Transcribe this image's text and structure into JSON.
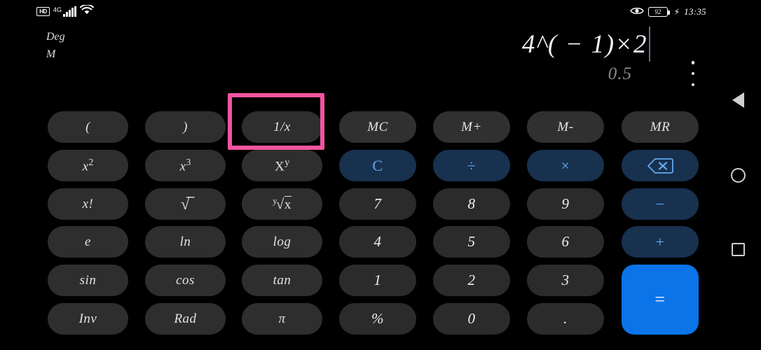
{
  "status_bar": {
    "hd_label": "HD",
    "network_label": "4G",
    "signal_icon": "signal-bars-icon",
    "wifi_icon": "wifi-icon",
    "eye_icon": "eye-icon",
    "battery_level": "92",
    "charging_icon": "charging-bolt-icon",
    "time": "13:35"
  },
  "display": {
    "angle_mode": "Deg",
    "memory_indicator": "M",
    "expression": "4^( − 1)×2",
    "result_preview": "0.5",
    "overflow_menu_icon": "overflow-menu-icon"
  },
  "annotation": {
    "highlight_color": "#f2559e",
    "highlighted_key": "1/x"
  },
  "keypad": {
    "keys": [
      {
        "id": "paren-open",
        "label": "(",
        "type": "fn",
        "col": 0,
        "row": 0
      },
      {
        "id": "paren-close",
        "label": ")",
        "type": "fn",
        "col": 1,
        "row": 0
      },
      {
        "id": "reciprocal",
        "label": "1/x",
        "type": "fn",
        "col": 2,
        "row": 0
      },
      {
        "id": "mem-clear",
        "label": "MC",
        "type": "mem",
        "col": 3,
        "row": 0
      },
      {
        "id": "mem-plus",
        "label": "M+",
        "type": "mem",
        "col": 4,
        "row": 0
      },
      {
        "id": "mem-minus",
        "label": "M-",
        "type": "mem",
        "col": 5,
        "row": 0
      },
      {
        "id": "mem-recall",
        "label": "MR",
        "type": "mem",
        "col": 6,
        "row": 0
      },
      {
        "id": "x-squared",
        "label": "x2",
        "type": "fn",
        "col": 0,
        "row": 1
      },
      {
        "id": "x-cubed",
        "label": "x3",
        "type": "fn",
        "col": 1,
        "row": 1
      },
      {
        "id": "x-pow-y",
        "label": "Xy",
        "type": "fn",
        "col": 2,
        "row": 1
      },
      {
        "id": "clear",
        "label": "C",
        "type": "op",
        "col": 3,
        "row": 1
      },
      {
        "id": "divide",
        "label": "÷",
        "type": "op",
        "col": 4,
        "row": 1
      },
      {
        "id": "multiply",
        "label": "×",
        "type": "op",
        "col": 5,
        "row": 1
      },
      {
        "id": "backspace",
        "label": "backspace-icon",
        "type": "op",
        "col": 6,
        "row": 1
      },
      {
        "id": "factorial",
        "label": "x!",
        "type": "fn",
        "col": 0,
        "row": 2
      },
      {
        "id": "sqrt",
        "label": "√",
        "type": "fn",
        "col": 1,
        "row": 2
      },
      {
        "id": "nth-root",
        "label": "y√x",
        "type": "fn",
        "col": 2,
        "row": 2
      },
      {
        "id": "digit-7",
        "label": "7",
        "type": "num",
        "col": 3,
        "row": 2
      },
      {
        "id": "digit-8",
        "label": "8",
        "type": "num",
        "col": 4,
        "row": 2
      },
      {
        "id": "digit-9",
        "label": "9",
        "type": "num",
        "col": 5,
        "row": 2
      },
      {
        "id": "subtract",
        "label": "−",
        "type": "op",
        "col": 6,
        "row": 2
      },
      {
        "id": "euler",
        "label": "e",
        "type": "fn",
        "col": 0,
        "row": 3
      },
      {
        "id": "natural-log",
        "label": "ln",
        "type": "fn",
        "col": 1,
        "row": 3
      },
      {
        "id": "log",
        "label": "log",
        "type": "fn",
        "col": 2,
        "row": 3
      },
      {
        "id": "digit-4",
        "label": "4",
        "type": "num",
        "col": 3,
        "row": 3
      },
      {
        "id": "digit-5",
        "label": "5",
        "type": "num",
        "col": 4,
        "row": 3
      },
      {
        "id": "digit-6",
        "label": "6",
        "type": "num",
        "col": 5,
        "row": 3
      },
      {
        "id": "add",
        "label": "+",
        "type": "op",
        "col": 6,
        "row": 3
      },
      {
        "id": "sin",
        "label": "sin",
        "type": "fn",
        "col": 0,
        "row": 4
      },
      {
        "id": "cos",
        "label": "cos",
        "type": "fn",
        "col": 1,
        "row": 4
      },
      {
        "id": "tan",
        "label": "tan",
        "type": "fn",
        "col": 2,
        "row": 4
      },
      {
        "id": "digit-1",
        "label": "1",
        "type": "num",
        "col": 3,
        "row": 4
      },
      {
        "id": "digit-2",
        "label": "2",
        "type": "num",
        "col": 4,
        "row": 4
      },
      {
        "id": "digit-3",
        "label": "3",
        "type": "num",
        "col": 5,
        "row": 4
      },
      {
        "id": "equals",
        "label": "=",
        "type": "equals",
        "col": 6,
        "row": 4,
        "tall": true
      },
      {
        "id": "inverse",
        "label": "Inv",
        "type": "fn",
        "col": 0,
        "row": 5
      },
      {
        "id": "radian",
        "label": "Rad",
        "type": "fn",
        "col": 1,
        "row": 5
      },
      {
        "id": "pi",
        "label": "π",
        "type": "fn",
        "col": 2,
        "row": 5
      },
      {
        "id": "percent",
        "label": "%",
        "type": "num",
        "col": 3,
        "row": 5
      },
      {
        "id": "digit-0",
        "label": "0",
        "type": "num",
        "col": 4,
        "row": 5
      },
      {
        "id": "decimal",
        "label": ".",
        "type": "num",
        "col": 5,
        "row": 5
      }
    ]
  },
  "nav_bar": {
    "back_icon": "back-triangle-icon",
    "home_icon": "home-circle-icon",
    "recent_icon": "recent-apps-square-icon"
  }
}
